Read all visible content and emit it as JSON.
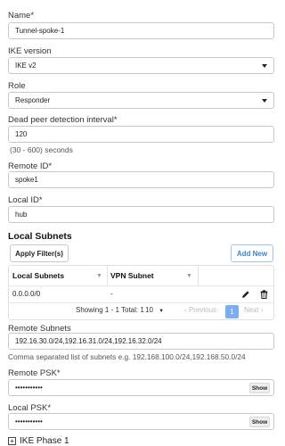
{
  "form": {
    "name": {
      "label": "Name*",
      "value": "Tunnel-spoke-1"
    },
    "ike_version": {
      "label": "IKE version",
      "value": "IKE v2"
    },
    "role": {
      "label": "Role",
      "value": "Responder"
    },
    "dpd": {
      "label": "Dead peer detection interval*",
      "value": "120",
      "hint": "(30 - 600) seconds"
    },
    "remote_id": {
      "label": "Remote ID*",
      "value": "spoke1"
    },
    "local_id": {
      "label": "Local ID*",
      "value": "hub"
    }
  },
  "local_subnets": {
    "title": "Local Subnets",
    "apply_filter_label": "Apply Filter(s)",
    "add_new_label": "Add New",
    "columns": [
      "Local Subnets",
      "VPN Subnet"
    ],
    "rows": [
      {
        "local_subnet": "0.0.0.0/0",
        "vpn_subnet": "-"
      }
    ],
    "pagination": {
      "showing": "Showing 1 - 1 Total: 1",
      "page_size": "10",
      "previous": "Previous",
      "current_page": "1",
      "next": "Next"
    }
  },
  "remote_subnets": {
    "label": "Remote Subnets",
    "value": "192.16.30.0/24,192.16.31.0/24,192.16.32.0/24",
    "hint": "Comma separated list of subnets e.g. 192.168.100.0/24,192.168.50.0/24"
  },
  "remote_psk": {
    "label": "Remote PSK*",
    "value": "•••••••••••",
    "show_label": "Show"
  },
  "local_psk": {
    "label": "Local PSK*",
    "value": "•••••••••••",
    "show_label": "Show"
  },
  "ike_phase": {
    "label": "IKE Phase 1"
  },
  "colors": {
    "accent": "#3a82d6",
    "active_page": "#7aaef0"
  }
}
